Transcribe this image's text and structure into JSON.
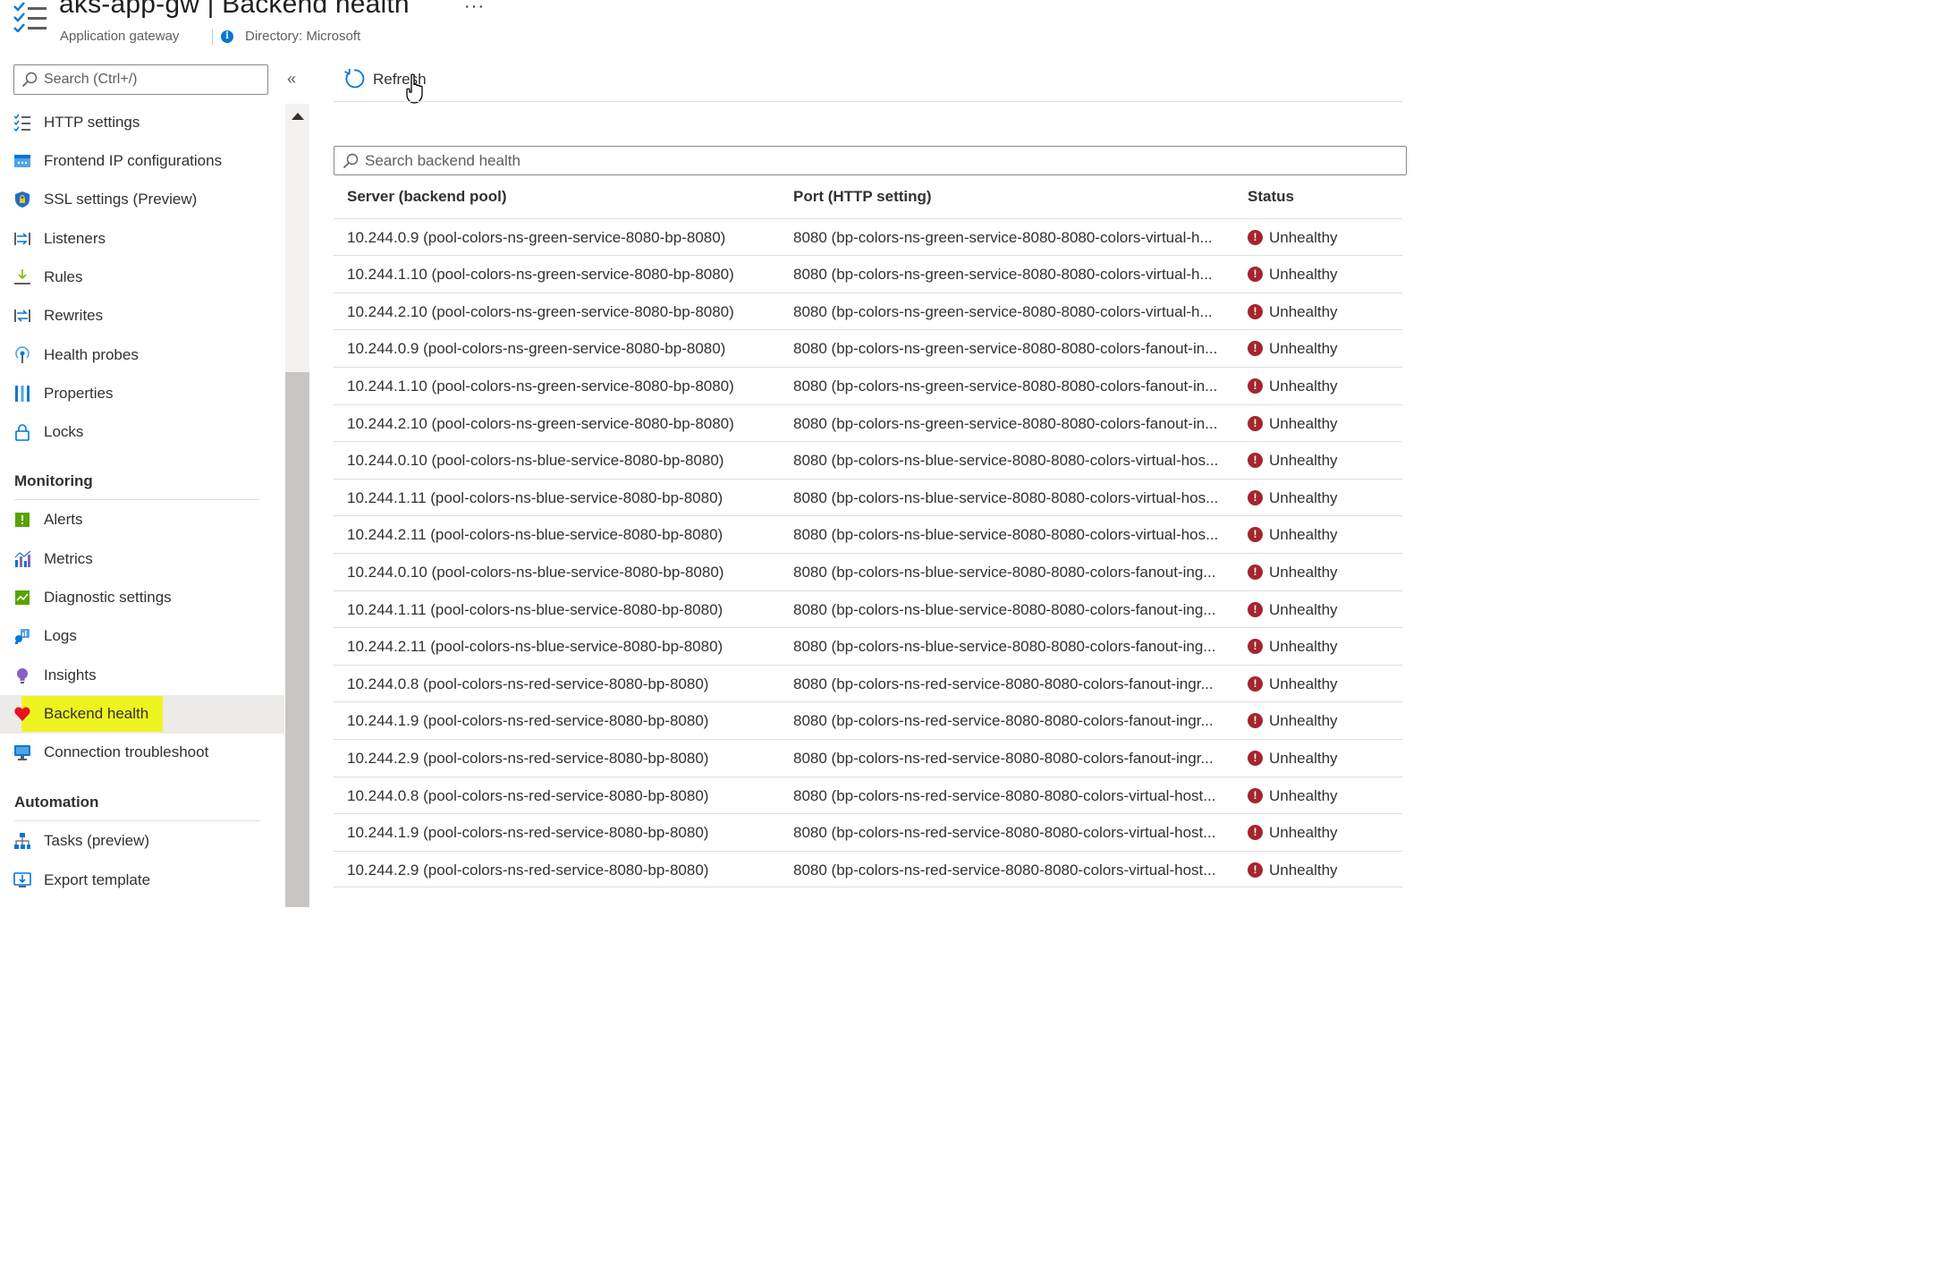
{
  "header": {
    "title": "aks-app-gw | Backend health",
    "more": "···",
    "subtitle": "Application gateway",
    "directory": "Directory: Microsoft",
    "app_icon": "list-check-icon"
  },
  "sidebar": {
    "search_placeholder": "Search (Ctrl+/)",
    "collapse_glyph": "«",
    "items_top": [
      {
        "label": "HTTP settings",
        "icon": "list-check-icon"
      },
      {
        "label": "Frontend IP configurations",
        "icon": "frontend-ip-icon"
      },
      {
        "label": "SSL settings (Preview)",
        "icon": "shield-lock-icon"
      },
      {
        "label": "Listeners",
        "icon": "listeners-icon"
      },
      {
        "label": "Rules",
        "icon": "rules-icon"
      },
      {
        "label": "Rewrites",
        "icon": "rewrites-icon"
      },
      {
        "label": "Health probes",
        "icon": "health-probe-icon"
      },
      {
        "label": "Properties",
        "icon": "properties-icon"
      },
      {
        "label": "Locks",
        "icon": "lock-icon"
      }
    ],
    "monitoring_header": "Monitoring",
    "items_monitoring": [
      {
        "label": "Alerts",
        "icon": "alert-icon"
      },
      {
        "label": "Metrics",
        "icon": "metrics-icon"
      },
      {
        "label": "Diagnostic settings",
        "icon": "diagnostic-icon"
      },
      {
        "label": "Logs",
        "icon": "logs-icon"
      },
      {
        "label": "Insights",
        "icon": "insights-bulb-icon"
      },
      {
        "label": "Backend health",
        "icon": "heart-icon",
        "selected": true
      },
      {
        "label": "Connection troubleshoot",
        "icon": "monitor-icon"
      }
    ],
    "automation_header": "Automation",
    "items_automation": [
      {
        "label": "Tasks (preview)",
        "icon": "tasks-icon"
      },
      {
        "label": "Export template",
        "icon": "export-template-icon"
      }
    ]
  },
  "toolbar": {
    "refresh_label": "Refresh",
    "refresh_icon": "refresh-icon"
  },
  "table": {
    "search_placeholder": "Search backend health",
    "columns": [
      "Server (backend pool)",
      "Port (HTTP setting)",
      "Status"
    ],
    "rows": [
      {
        "server": "10.244.0.9 (pool-colors-ns-green-service-8080-bp-8080)",
        "port": "8080 (bp-colors-ns-green-service-8080-8080-colors-virtual-h...",
        "status": "Unhealthy"
      },
      {
        "server": "10.244.1.10 (pool-colors-ns-green-service-8080-bp-8080)",
        "port": "8080 (bp-colors-ns-green-service-8080-8080-colors-virtual-h...",
        "status": "Unhealthy"
      },
      {
        "server": "10.244.2.10 (pool-colors-ns-green-service-8080-bp-8080)",
        "port": "8080 (bp-colors-ns-green-service-8080-8080-colors-virtual-h...",
        "status": "Unhealthy"
      },
      {
        "server": "10.244.0.9 (pool-colors-ns-green-service-8080-bp-8080)",
        "port": "8080 (bp-colors-ns-green-service-8080-8080-colors-fanout-in...",
        "status": "Unhealthy"
      },
      {
        "server": "10.244.1.10 (pool-colors-ns-green-service-8080-bp-8080)",
        "port": "8080 (bp-colors-ns-green-service-8080-8080-colors-fanout-in...",
        "status": "Unhealthy"
      },
      {
        "server": "10.244.2.10 (pool-colors-ns-green-service-8080-bp-8080)",
        "port": "8080 (bp-colors-ns-green-service-8080-8080-colors-fanout-in...",
        "status": "Unhealthy"
      },
      {
        "server": "10.244.0.10 (pool-colors-ns-blue-service-8080-bp-8080)",
        "port": "8080 (bp-colors-ns-blue-service-8080-8080-colors-virtual-hos...",
        "status": "Unhealthy"
      },
      {
        "server": "10.244.1.11 (pool-colors-ns-blue-service-8080-bp-8080)",
        "port": "8080 (bp-colors-ns-blue-service-8080-8080-colors-virtual-hos...",
        "status": "Unhealthy"
      },
      {
        "server": "10.244.2.11 (pool-colors-ns-blue-service-8080-bp-8080)",
        "port": "8080 (bp-colors-ns-blue-service-8080-8080-colors-virtual-hos...",
        "status": "Unhealthy"
      },
      {
        "server": "10.244.0.10 (pool-colors-ns-blue-service-8080-bp-8080)",
        "port": "8080 (bp-colors-ns-blue-service-8080-8080-colors-fanout-ing...",
        "status": "Unhealthy"
      },
      {
        "server": "10.244.1.11 (pool-colors-ns-blue-service-8080-bp-8080)",
        "port": "8080 (bp-colors-ns-blue-service-8080-8080-colors-fanout-ing...",
        "status": "Unhealthy"
      },
      {
        "server": "10.244.2.11 (pool-colors-ns-blue-service-8080-bp-8080)",
        "port": "8080 (bp-colors-ns-blue-service-8080-8080-colors-fanout-ing...",
        "status": "Unhealthy"
      },
      {
        "server": "10.244.0.8 (pool-colors-ns-red-service-8080-bp-8080)",
        "port": "8080 (bp-colors-ns-red-service-8080-8080-colors-fanout-ingr...",
        "status": "Unhealthy"
      },
      {
        "server": "10.244.1.9 (pool-colors-ns-red-service-8080-bp-8080)",
        "port": "8080 (bp-colors-ns-red-service-8080-8080-colors-fanout-ingr...",
        "status": "Unhealthy"
      },
      {
        "server": "10.244.2.9 (pool-colors-ns-red-service-8080-bp-8080)",
        "port": "8080 (bp-colors-ns-red-service-8080-8080-colors-fanout-ingr...",
        "status": "Unhealthy"
      },
      {
        "server": "10.244.0.8 (pool-colors-ns-red-service-8080-bp-8080)",
        "port": "8080 (bp-colors-ns-red-service-8080-8080-colors-virtual-host...",
        "status": "Unhealthy"
      },
      {
        "server": "10.244.1.9 (pool-colors-ns-red-service-8080-bp-8080)",
        "port": "8080 (bp-colors-ns-red-service-8080-8080-colors-virtual-host...",
        "status": "Unhealthy"
      },
      {
        "server": "10.244.2.9 (pool-colors-ns-red-service-8080-bp-8080)",
        "port": "8080 (bp-colors-ns-red-service-8080-8080-colors-virtual-host...",
        "status": "Unhealthy"
      }
    ]
  },
  "colors": {
    "accent": "#0078d4",
    "unhealthy": "#a4262c",
    "selected_highlight": "#eef41f"
  }
}
